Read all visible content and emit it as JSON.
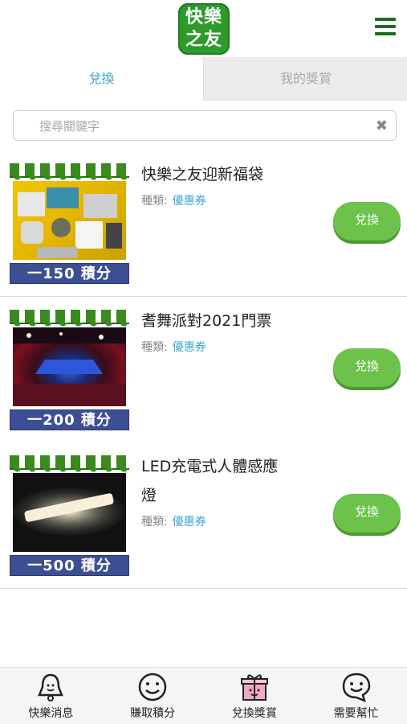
{
  "header": {
    "logo_line1": "快樂",
    "logo_line2": "之友",
    "menu_icon": "hamburger-menu-icon"
  },
  "tabs": [
    {
      "label": "兌換",
      "active": true
    },
    {
      "label": "我的獎賞",
      "active": false
    }
  ],
  "search": {
    "placeholder": "搜尋關鍵字",
    "value": ""
  },
  "items": [
    {
      "title_line1": "快樂之友迎新福袋",
      "title_line2": "",
      "category_label": "種類:",
      "category_value": "優惠券",
      "price": "一150 積分",
      "button": "兌換"
    },
    {
      "title_line1": "耆舞派對2021門票",
      "title_line2": "",
      "category_label": "種類:",
      "category_value": "優惠券",
      "price": "一200 積分",
      "button": "兌換"
    },
    {
      "title_line1": "LED充電式人體感應",
      "title_line2": "燈",
      "category_label": "種類:",
      "category_value": "優惠券",
      "price": "一500 積分",
      "button": "兌換"
    }
  ],
  "bottom_nav": [
    {
      "label": "快樂消息",
      "icon": "bell-icon"
    },
    {
      "label": "賺取積分",
      "icon": "smiley-icon"
    },
    {
      "label": "兌換獎賞",
      "icon": "gift-icon",
      "active": true
    },
    {
      "label": "需要幫忙",
      "icon": "help-chat-icon"
    }
  ],
  "colors": {
    "brand_green": "#2e9a2c",
    "accent_blue": "#3aa6d0",
    "button_green": "#6cc24a",
    "price_bar": "#3d4f94"
  }
}
